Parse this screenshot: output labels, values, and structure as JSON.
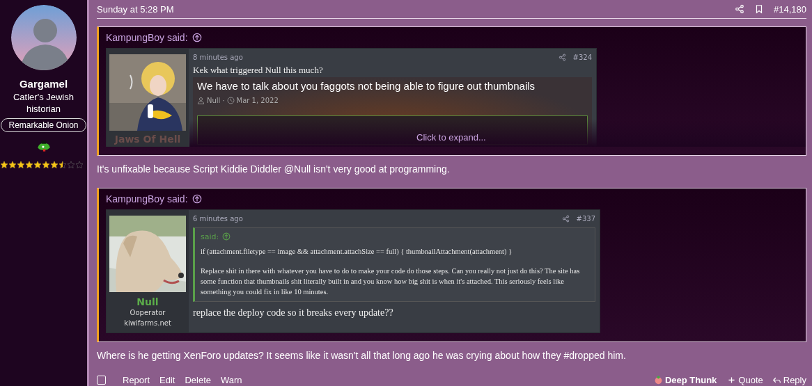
{
  "author": {
    "name": "Gargamel",
    "title": "Catler's Jewish historian",
    "banner": "Remarkable Onion",
    "stars": 7.5
  },
  "post": {
    "date": "Sunday at 5:28 PM",
    "number": "#14,180"
  },
  "content": [
    {
      "kind": "quote",
      "attribution": "KampungBoy said:",
      "embed": {
        "user": {
          "name": "Jaws Of Hell"
        },
        "time": "8 minutes ago",
        "number": "#324",
        "message": "Kek what triggered Null this much?",
        "preview": {
          "title": "We have to talk about you faggots not being able to figure out thumbnails",
          "author": "Null",
          "separator": "·",
          "date": "Mar 1, 2022"
        }
      },
      "expand": "Click to expand..."
    },
    {
      "kind": "text",
      "text": "It's unfixable because Script Kiddie Diddler @Null isn't very good at programming."
    },
    {
      "kind": "quote",
      "attribution": "KampungBoy said:",
      "embed": {
        "user": {
          "name": "Null",
          "title": "Ooperator",
          "site": "kiwifarms.net"
        },
        "time": "6 minutes ago",
        "number": "#337",
        "inner_quote": {
          "attribution": "said:",
          "paragraphs": [
            "if (attachment.filetype == image && attachment.attachSize == full) { thumbnailAttachment(attachment) }",
            "Replace shit in there with whatever you have to do to make your code do those steps. Can you really not just do this? The site has some function that thumbnails shit literally built in and you know how big shit is when it's attached. This seriously feels like something you could fix in like 10 minutes."
          ]
        },
        "message": "replace the deploy code so it breaks every update??"
      }
    },
    {
      "kind": "text",
      "text": "Where is he getting XenForo updates? It seems like it wasn't all that long ago he was crying about how they #dropped him."
    }
  ],
  "actions": {
    "selected": false,
    "left": [
      "Report",
      "Edit",
      "Delete",
      "Warn"
    ],
    "reaction": "Deep Thunk",
    "quote": "Quote",
    "reply": "Reply"
  }
}
